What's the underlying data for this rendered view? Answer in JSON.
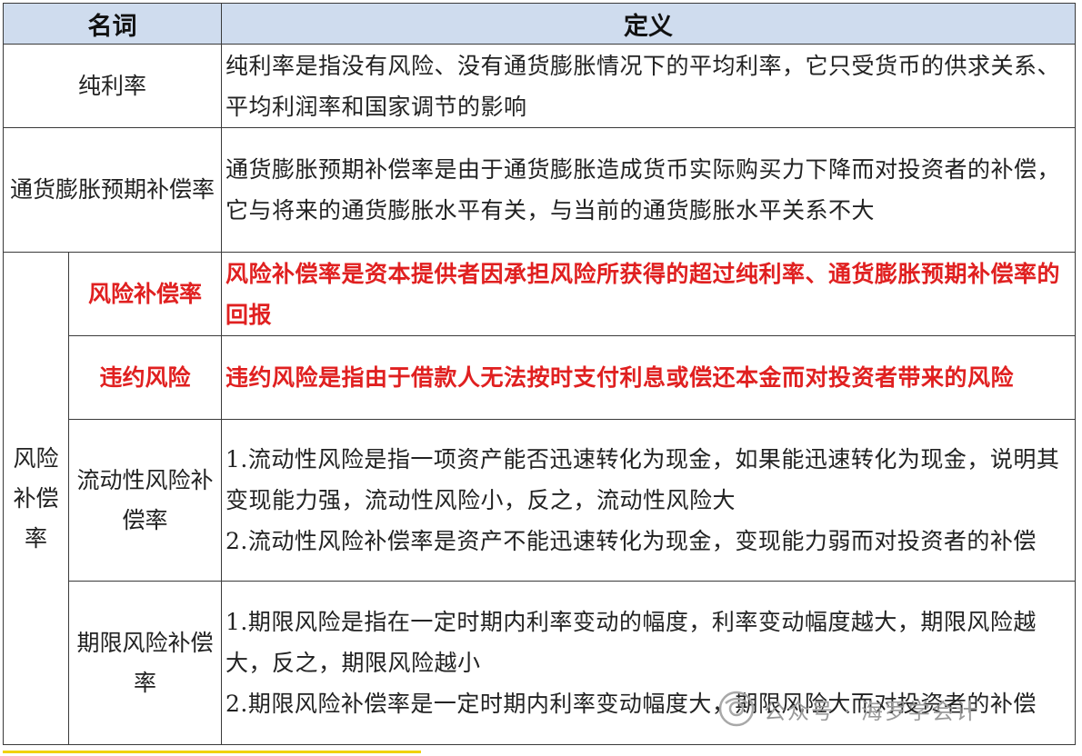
{
  "header": {
    "term": "名词",
    "definition": "定义"
  },
  "rows": {
    "pure_rate": {
      "term": "纯利率",
      "definition": "纯利率是指没有风险、没有通货膨胀情况下的平均利率，它只受货币的供求关系、平均利润率和国家调节的影响"
    },
    "inflation": {
      "term": "通货膨胀预期补偿率",
      "definition": "通货膨胀预期补偿率是由于通货膨胀造成货币实际购买力下降而对投资者的补偿，它与将来的通货膨胀水平有关，与当前的通货膨胀水平关系不大"
    },
    "risk_group": {
      "label": "风险补偿率",
      "items": {
        "risk_comp": {
          "term": "风险补偿率",
          "definition": "风险补偿率是资本提供者因承担风险所获得的超过纯利率、通货膨胀预期补偿率的回报"
        },
        "default": {
          "term": "违约风险",
          "definition": "违约风险是指由于借款人无法按时支付利息或偿还本金而对投资者带来的风险"
        },
        "liquidity": {
          "term": "流动性风险补偿率",
          "def1": "1.流动性风险是指一项资产能否迅速转化为现金，如果能迅速转化为现金，说明其变现能力强，流动性风险小，反之，流动性风险大",
          "def2": "2.流动性风险补偿率是资产不能迅速转化为现金，变现能力弱而对投资者的补偿"
        },
        "maturity": {
          "term": "期限风险补偿率",
          "def1": "1.期限风险是指在一定时期内利率变动的幅度，利率变动幅度越大，期限风险越大，反之，期限风险越小",
          "def2": "2.期限风险补偿率是一定时期内利率变动幅度大，期限风险大而对投资者的补偿"
        }
      }
    }
  },
  "watermark": {
    "text": "公众号 · 海罗学会计",
    "icon": "wechat-icon"
  },
  "colors": {
    "header_bg": "#cfdcee",
    "highlight": "#e02020",
    "border": "#3a3a3a"
  }
}
